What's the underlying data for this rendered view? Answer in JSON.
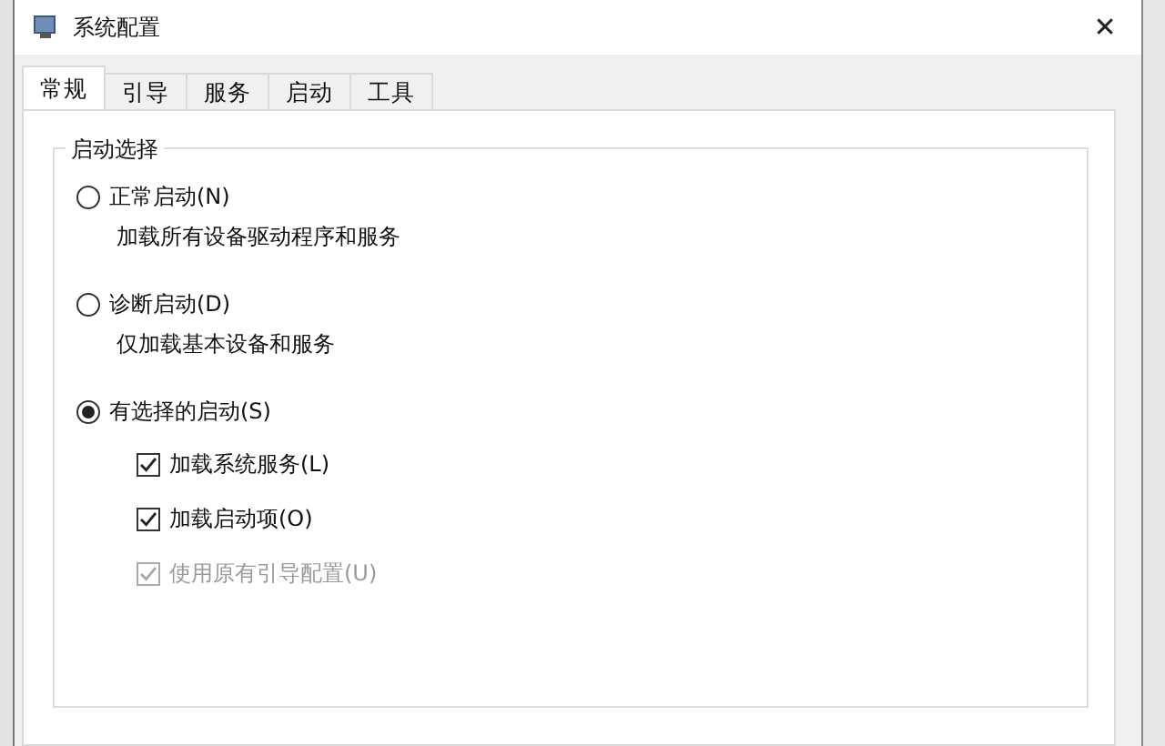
{
  "window": {
    "title": "系统配置",
    "close": "✕"
  },
  "tabs": [
    {
      "label": "常规",
      "selected": true
    },
    {
      "label": "引导",
      "selected": false
    },
    {
      "label": "服务",
      "selected": false
    },
    {
      "label": "启动",
      "selected": false
    },
    {
      "label": "工具",
      "selected": false
    }
  ],
  "startup_selection": {
    "title": "启动选择",
    "modes": [
      {
        "label": "正常启动(N)",
        "description": "加载所有设备驱动程序和服务",
        "selected": false
      },
      {
        "label": "诊断启动(D)",
        "description": "仅加载基本设备和服务",
        "selected": false
      },
      {
        "label": "有选择的启动(S)",
        "selected": true
      }
    ],
    "options": [
      {
        "label": "加载系统服务(L)",
        "checked": true,
        "disabled": false
      },
      {
        "label": "加载启动项(O)",
        "checked": true,
        "disabled": false
      },
      {
        "label": "使用原有引导配置(U)",
        "checked": true,
        "disabled": true
      }
    ]
  }
}
